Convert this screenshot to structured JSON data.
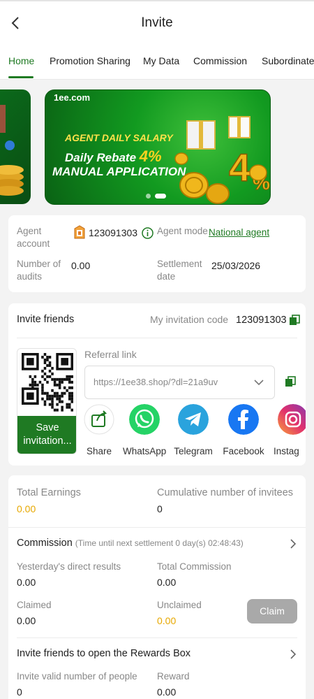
{
  "header": {
    "title": "Invite",
    "back_icon": "chevron-left-icon"
  },
  "tabs": [
    {
      "label": "Home",
      "active": true
    },
    {
      "label": "Promotion Sharing",
      "active": false
    },
    {
      "label": "My Data",
      "active": false
    },
    {
      "label": "Commission",
      "active": false
    },
    {
      "label": "Subordinate",
      "active": false
    }
  ],
  "banner": {
    "brand": "1ee.com",
    "line1": "AGENT DAILY SALARY",
    "line2_prefix": "Daily Rebate",
    "line2_pct": "4%",
    "line3": "MANUAL APPLICATION",
    "page_count": 2,
    "active_page": 2
  },
  "agent": {
    "account_label": "Agent account",
    "account_value": "123091303",
    "mode_label": "Agent mode",
    "mode_value": "National agent",
    "audits_label": "Number of audits",
    "audits_value": "0.00",
    "settlement_label": "Settlement date",
    "settlement_value": "25/03/2026"
  },
  "invite": {
    "title": "Invite friends",
    "code_label": "My invitation code",
    "code_value": "123091303",
    "referral_label": "Referral link",
    "referral_value": "https://1ee38.shop/?dl=21a9uv",
    "save_button": "Save invitation...",
    "share_targets": [
      {
        "label": "Share",
        "icon": "share-icon"
      },
      {
        "label": "WhatsApp",
        "icon": "whatsapp-icon"
      },
      {
        "label": "Telegram",
        "icon": "telegram-icon"
      },
      {
        "label": "Facebook",
        "icon": "facebook-icon"
      },
      {
        "label": "Instag",
        "icon": "instagram-icon"
      }
    ]
  },
  "earnings": {
    "total_label": "Total Earnings",
    "total_value": "0.00",
    "invitees_label": "Cumulative number of invitees",
    "invitees_value": "0"
  },
  "commission": {
    "title": "Commission",
    "countdown_text": "(Time until next settlement  0 day(s) 02:48:43)",
    "yesterday_label": "Yesterday's direct results",
    "yesterday_value": "0.00",
    "total_label": "Total Commission",
    "total_value": "0.00",
    "claimed_label": "Claimed",
    "claimed_value": "0.00",
    "unclaimed_label": "Unclaimed",
    "unclaimed_value": "0.00",
    "claim_button": "Claim"
  },
  "rewards": {
    "title": "Invite friends to open the Rewards Box",
    "valid_label": "Invite valid number of people",
    "valid_value": "0",
    "reward_label": "Reward",
    "reward_value": "0.00"
  },
  "colors": {
    "primary": "#1f7a23",
    "gold": "#e7a800",
    "disabled": "#a9a9a9"
  }
}
